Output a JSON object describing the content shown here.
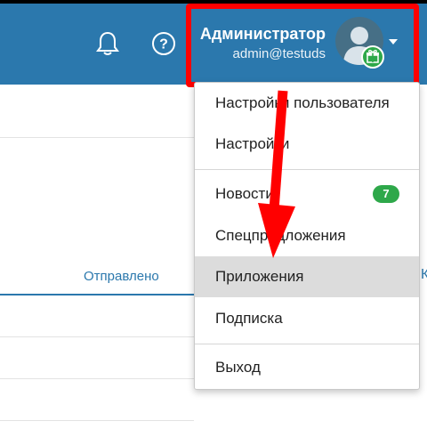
{
  "header": {
    "notifications_icon": "bell-icon",
    "help_icon": "help-circle-icon",
    "user": {
      "name": "Администратор",
      "email": "admin@testuds",
      "avatar_icon": "user-silhouette-icon",
      "badge_icon": "gift-icon",
      "badge_color": "#2ea84a"
    },
    "background_color": "#2b78ad",
    "highlight_color": "#ff0000"
  },
  "page": {
    "tabs": [
      {
        "label": "Отправлено"
      },
      {
        "label": "К"
      }
    ]
  },
  "user_menu": {
    "items": [
      {
        "label": "Настройки пользователя"
      },
      {
        "label": "Настройки"
      },
      {
        "label": "Новости",
        "count": "7"
      },
      {
        "label": "Спецпредложения"
      },
      {
        "label": "Приложения",
        "active": true
      },
      {
        "label": "Подписка"
      },
      {
        "label": "Выход"
      }
    ],
    "count_color": "#2ea84a"
  },
  "annotation": {
    "arrow_icon": "red-arrow-icon",
    "color": "#ff0000"
  }
}
